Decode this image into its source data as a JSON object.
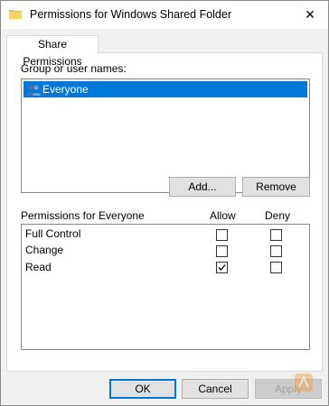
{
  "window": {
    "title": "Permissions for Windows Shared Folder",
    "close_glyph": "✕"
  },
  "tabs": [
    {
      "label": "Share Permissions",
      "active": true
    }
  ],
  "groups": {
    "label": "Group or user names:",
    "items": [
      {
        "name": "Everyone",
        "icon": "users-icon",
        "selected": true
      }
    ],
    "add_label": "Add...",
    "remove_label": "Remove"
  },
  "permissions": {
    "header": "Permissions for Everyone",
    "allow_header": "Allow",
    "deny_header": "Deny",
    "rows": [
      {
        "name": "Full Control",
        "allow": false,
        "deny": false
      },
      {
        "name": "Change",
        "allow": false,
        "deny": false
      },
      {
        "name": "Read",
        "allow": true,
        "deny": false
      }
    ]
  },
  "footer": {
    "ok_label": "OK",
    "cancel_label": "Cancel",
    "apply_label": "Apply"
  },
  "colors": {
    "selection": "#0078d7",
    "window_bg": "#f0f0f0"
  }
}
